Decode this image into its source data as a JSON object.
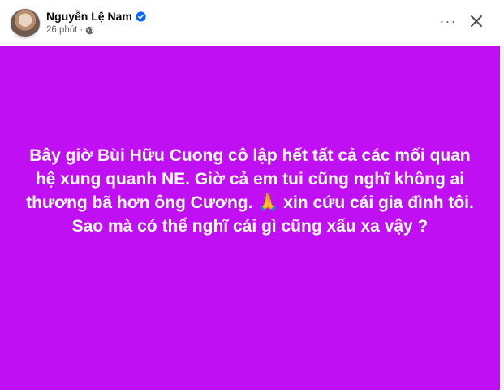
{
  "post": {
    "author_name": "Nguyễn Lệ Nam",
    "timestamp": "26 phút",
    "separator": "·",
    "privacy_icon": "globe-icon",
    "verified_icon": "verified-badge-icon",
    "more_label": "···",
    "close_icon": "close-icon",
    "background_color": "#c10ff3",
    "text": "Bây giờ Bùi Hữu Cuong cô lập hết tất cả các mối quan\nhệ xung quanh NE. Giờ cả em tui cũng nghĩ không ai\nthương bã hơn ông Cương. 🙏 xin cứu cái gia đình tôi.\nSao mà có thể nghĩ cái gì cũng xấu xa vậy ?"
  }
}
